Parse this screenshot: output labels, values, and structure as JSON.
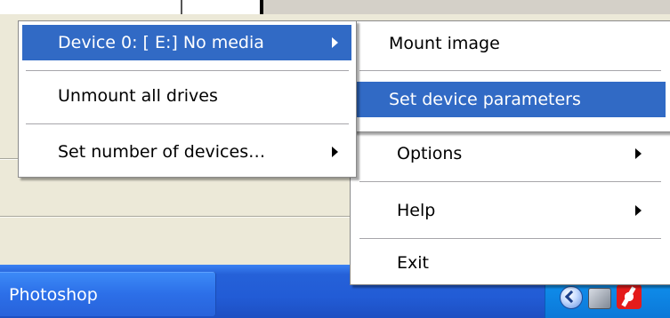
{
  "desktop_menu": {
    "items": [
      {
        "label": "Device 0: [ E:] No media",
        "has_submenu": true,
        "highlighted": true
      },
      {
        "label": "Unmount all drives",
        "has_submenu": false,
        "highlighted": false
      },
      {
        "label": "Set number of devices…",
        "has_submenu": true,
        "highlighted": false
      }
    ]
  },
  "device_submenu": {
    "items": [
      {
        "label": "Mount image",
        "highlighted": false
      },
      {
        "label": "Set device parameters",
        "highlighted": true
      }
    ]
  },
  "tray_menu": {
    "items": [
      {
        "label": "Options",
        "has_submenu": true
      },
      {
        "label": "Help",
        "has_submenu": true
      },
      {
        "label": "Exit",
        "has_submenu": false
      }
    ]
  },
  "taskbar": {
    "button_label": "Photoshop",
    "tray_icons": [
      "show-hidden-icons-icon",
      "network-icon",
      "daemon-tools-icon"
    ]
  },
  "colors": {
    "highlight": "#316ac5",
    "taskbar": "#225cd6",
    "menu_bg": "#ffffff"
  }
}
